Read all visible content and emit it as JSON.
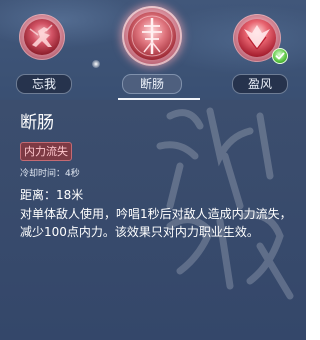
{
  "skills": [
    {
      "name": "忘我",
      "icon": "martial-figure-icon",
      "active": false,
      "equipped": false
    },
    {
      "name": "断肠",
      "icon": "sword-sigil-icon",
      "active": true,
      "equipped": false
    },
    {
      "name": "盈风",
      "icon": "wing-burst-icon",
      "active": false,
      "equipped": true
    }
  ],
  "detail": {
    "title": "断肠",
    "tag": "内力流失",
    "cooldown": "冷却时间：4秒",
    "distance": "距离：18米",
    "description": "对单体敌人使用，吟唱1秒后对敌人造成内力流失，减少100点内力。该效果只对内力职业生效。"
  },
  "colors": {
    "background": "#3a5073",
    "tag_bg": "#7d3a44",
    "tag_text": "#ffc6cc",
    "check": "#57c23e"
  }
}
